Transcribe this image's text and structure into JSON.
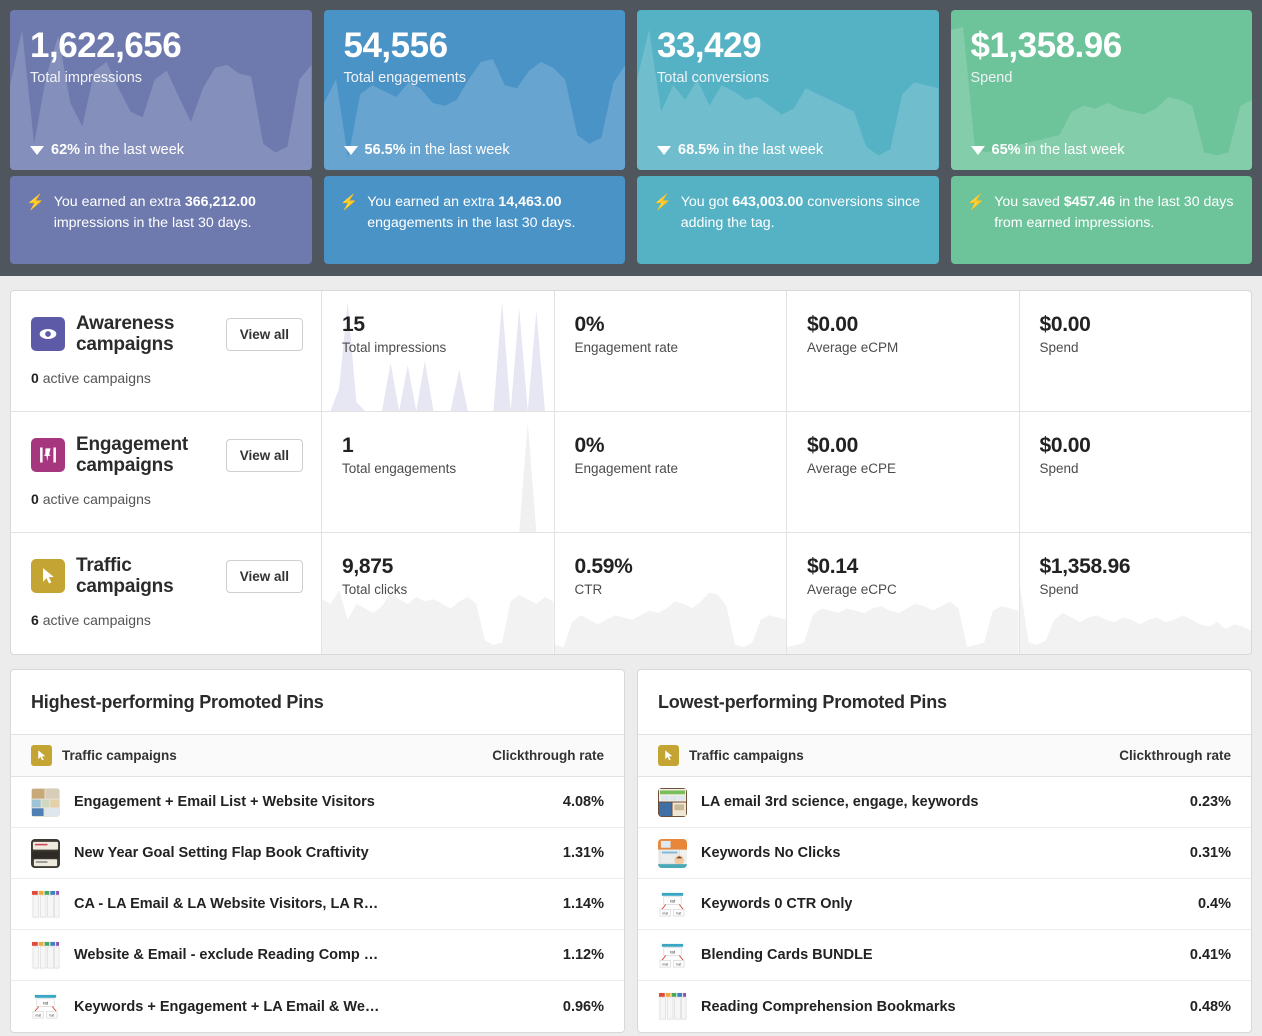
{
  "colors": {
    "band_bg": "#4f565e",
    "page_bg": "#ececec",
    "impressions": "#6e7aae",
    "engagements": "#4a93c6",
    "conversions": "#55b2c4",
    "spend": "#6dc49b",
    "awareness_icon": "#5d5ba8",
    "engagement_icon": "#a6377e",
    "traffic_icon": "#c4a432"
  },
  "kpis": [
    {
      "value": "1,622,656",
      "label": "Total impressions",
      "delta_pct": "62%",
      "delta_suffix": "in the last week",
      "delta_direction": "down",
      "note_prefix": "You earned an extra",
      "note_bold": "366,212.00",
      "note_suffix": "impressions in the last 30 days.",
      "color": "#6e7aae",
      "spark": [
        58,
        96,
        18,
        64,
        92,
        46,
        30,
        68,
        74,
        56,
        40,
        36,
        62,
        68,
        50,
        33,
        56,
        70,
        72,
        66,
        64,
        18,
        12,
        16,
        62,
        72
      ]
    },
    {
      "value": "54,556",
      "label": "Total engagements",
      "delta_pct": "56.5%",
      "delta_suffix": "in the last week",
      "delta_direction": "down",
      "note_prefix": "You earned an extra",
      "note_bold": "14,463.00",
      "note_suffix": "engagements in the last 30 days.",
      "color": "#4a93c6",
      "spark": [
        46,
        62,
        8,
        52,
        58,
        54,
        50,
        60,
        56,
        46,
        44,
        48,
        62,
        74,
        76,
        58,
        56,
        68,
        74,
        70,
        62,
        24,
        18,
        22,
        60,
        72
      ]
    },
    {
      "value": "33,429",
      "label": "Total conversions",
      "delta_pct": "68.5%",
      "delta_suffix": "in the last week",
      "delta_direction": "down",
      "note_prefix": "You got",
      "note_bold": "643,003.00",
      "note_suffix": "conversions since adding the tag.",
      "color": "#55b2c4",
      "spark": [
        62,
        96,
        40,
        58,
        48,
        62,
        44,
        58,
        54,
        48,
        50,
        44,
        38,
        42,
        56,
        52,
        48,
        44,
        40,
        16,
        10,
        14,
        52,
        60,
        58,
        56
      ]
    },
    {
      "value": "$1,358.96",
      "label": "Spend",
      "delta_pct": "65%",
      "delta_suffix": "in the last week",
      "delta_direction": "down",
      "note_prefix": "You saved",
      "note_bold": "$457.46",
      "note_suffix": "in the last 30 days from earned impressions.",
      "color": "#6dc49b",
      "spark": [
        96,
        98,
        14,
        12,
        14,
        16,
        18,
        20,
        22,
        24,
        40,
        44,
        42,
        46,
        42,
        40,
        38,
        42,
        50,
        48,
        44,
        12,
        10,
        12,
        44,
        48
      ]
    }
  ],
  "campaigns": [
    {
      "icon": "eye-icon",
      "icon_color": "#5d5ba8",
      "name": "Awareness campaigns",
      "view_all": "View all",
      "active_count": "0",
      "active_suffix": "active campaigns",
      "spark_color": "#e7e6f3",
      "metrics": [
        {
          "value": "15",
          "label": "Total impressions",
          "spark": [
            0,
            0,
            20,
            96,
            8,
            0,
            0,
            0,
            42,
            0,
            40,
            0,
            44,
            0,
            0,
            0,
            36,
            0,
            0,
            0,
            0,
            96,
            0,
            90,
            0,
            88,
            0,
            0
          ]
        },
        {
          "value": "0%",
          "label": "Engagement rate",
          "spark": []
        },
        {
          "value": "$0.00",
          "label": "Average eCPM",
          "spark": []
        },
        {
          "value": "$0.00",
          "label": "Spend",
          "spark": []
        }
      ]
    },
    {
      "icon": "pin-icon",
      "icon_color": "#a6377e",
      "name": "Engagement campaigns",
      "view_all": "View all",
      "active_count": "0",
      "active_suffix": "active campaigns",
      "spark_color": "#f0f0f0",
      "metrics": [
        {
          "value": "1",
          "label": "Total engagements",
          "spark": [
            0,
            0,
            0,
            0,
            0,
            0,
            0,
            0,
            0,
            0,
            0,
            0,
            0,
            0,
            0,
            0,
            0,
            0,
            0,
            0,
            0,
            0,
            0,
            0,
            96,
            0,
            0,
            0
          ]
        },
        {
          "value": "0%",
          "label": "Engagement rate",
          "spark": []
        },
        {
          "value": "$0.00",
          "label": "Average eCPE",
          "spark": []
        },
        {
          "value": "$0.00",
          "label": "Spend",
          "spark": []
        }
      ]
    },
    {
      "icon": "cursor-icon",
      "icon_color": "#c4a432",
      "name": "Traffic campaigns",
      "view_all": "View all",
      "active_count": "6",
      "active_suffix": "active campaigns",
      "spark_color": "#f2f2f2",
      "metrics": [
        {
          "value": "9,875",
          "label": "Total clicks",
          "spark": [
            48,
            44,
            56,
            30,
            44,
            40,
            36,
            42,
            54,
            48,
            44,
            50,
            46,
            48,
            44,
            40,
            46,
            50,
            44,
            12,
            8,
            10,
            46,
            52,
            48,
            44,
            50,
            46
          ]
        },
        {
          "value": "0.59%",
          "label": "CTR",
          "spark": [
            8,
            6,
            28,
            34,
            30,
            26,
            30,
            34,
            32,
            30,
            34,
            38,
            36,
            40,
            46,
            44,
            40,
            46,
            54,
            52,
            42,
            8,
            6,
            10,
            30,
            34,
            32,
            30
          ]
        },
        {
          "value": "$0.14",
          "label": "Average eCPC",
          "spark": [
            6,
            8,
            10,
            34,
            40,
            38,
            36,
            40,
            38,
            36,
            40,
            42,
            38,
            36,
            40,
            44,
            42,
            38,
            42,
            46,
            40,
            6,
            8,
            10,
            38,
            42,
            40,
            38
          ]
        },
        {
          "value": "$1,358.96",
          "label": "Spend",
          "spark": [
            60,
            10,
            8,
            12,
            30,
            36,
            32,
            28,
            32,
            34,
            30,
            28,
            32,
            30,
            26,
            30,
            32,
            28,
            30,
            34,
            30,
            26,
            24,
            28,
            22,
            26,
            24,
            20
          ]
        }
      ]
    }
  ],
  "pin_tables": [
    {
      "title": "Highest-performing Promoted Pins",
      "col_campaign": "Traffic campaigns",
      "col_rate": "Clickthrough rate",
      "rows": [
        {
          "name": "Engagement + Email List + Website Visitors",
          "rate": "4.08%",
          "thumb": "collage"
        },
        {
          "name": "New Year Goal Setting Flap Book Craftivity",
          "rate": "1.31%",
          "thumb": "flapbook"
        },
        {
          "name": "CA - LA Email & LA Website Visitors, LA R…",
          "rate": "1.14%",
          "thumb": "bookmarks"
        },
        {
          "name": "Website & Email - exclude Reading Comp …",
          "rate": "1.12%",
          "thumb": "bookmarks"
        },
        {
          "name": "Keywords + Engagement + LA Email & We…",
          "rate": "0.96%",
          "thumb": "blending"
        }
      ]
    },
    {
      "title": "Lowest-performing Promoted Pins",
      "col_campaign": "Traffic campaigns",
      "col_rate": "Clickthrough rate",
      "rows": [
        {
          "name": "LA email 3rd science, engage, keywords",
          "rate": "0.23%",
          "thumb": "science"
        },
        {
          "name": "Keywords No Clicks",
          "rate": "0.31%",
          "thumb": "orangebook"
        },
        {
          "name": "Keywords 0 CTR Only",
          "rate": "0.4%",
          "thumb": "blending"
        },
        {
          "name": "Blending Cards BUNDLE",
          "rate": "0.41%",
          "thumb": "blending"
        },
        {
          "name": "Reading Comprehension Bookmarks",
          "rate": "0.48%",
          "thumb": "bookmarks"
        }
      ]
    }
  ]
}
